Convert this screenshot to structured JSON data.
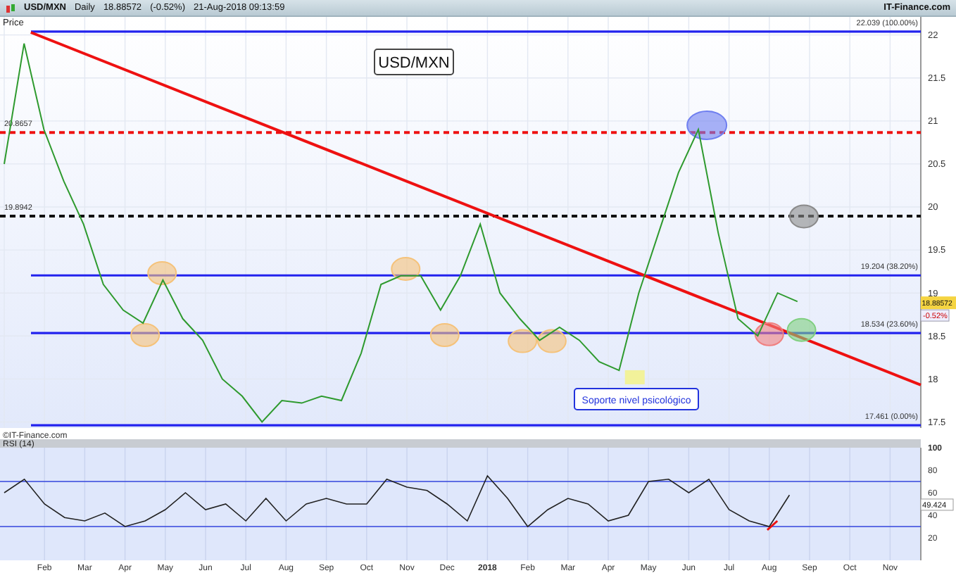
{
  "header": {
    "symbol": "USD/MXN",
    "interval": "Daily",
    "price": "18.88572",
    "change": "(-0.52%)",
    "timestamp": "21-Aug-2018 09:13:59",
    "source": "IT-Finance.com"
  },
  "price_panel": {
    "copyright": "©IT-Finance.com",
    "title_box": "USD/MXN",
    "callout": "Soporte nivel psicológico",
    "price_tag": "18.88572",
    "change_tag": "-0.52%",
    "chart_data": {
      "type": "line",
      "ylabel": "Price",
      "grid": true,
      "ylim": [
        17.43,
        22.21
      ],
      "yticks": [
        17.5,
        18,
        18.5,
        19,
        19.5,
        20,
        20.5,
        21,
        21.5,
        22
      ],
      "series": [
        {
          "color": "#2e9a2e",
          "values": [
            20.5,
            21.9,
            20.9,
            20.3,
            19.8,
            19.1,
            18.8,
            18.65,
            19.15,
            18.7,
            18.45,
            18.0,
            17.8,
            17.5,
            17.75,
            17.72,
            17.8,
            17.75,
            18.3,
            19.1,
            19.2,
            19.2,
            18.8,
            19.2,
            19.8,
            19.0,
            18.7,
            18.45,
            18.6,
            18.45,
            18.2,
            18.1,
            19.0,
            19.7,
            20.4,
            20.9,
            19.7,
            18.7,
            18.5,
            19.0,
            18.9
          ]
        }
      ],
      "ref_lines": [
        {
          "axis": "y",
          "value": 22.039,
          "label": "22.039 (100.00%)",
          "color": "#2222ee"
        },
        {
          "axis": "y",
          "value": 20.8657,
          "label": "20.8657",
          "color": "#ee1111"
        },
        {
          "axis": "y",
          "value": 19.8942,
          "label": "19.8942",
          "color": "#111111"
        },
        {
          "axis": "y",
          "value": 19.204,
          "label": "19.204 (38.20%)",
          "color": "#2222ee"
        },
        {
          "axis": "y",
          "value": 18.534,
          "label": "18.534 (23.60%)",
          "color": "#2222ee"
        },
        {
          "axis": "y",
          "value": 17.461,
          "label": "17.461 (0.00%)",
          "color": "#2222ee"
        }
      ]
    }
  },
  "rsi_panel": {
    "label": "RSI (14)",
    "value_tag": "49.424",
    "chart_data": {
      "type": "line",
      "grid": true,
      "ylim": [
        0,
        100
      ],
      "yticks": [
        20,
        40,
        60,
        80,
        100
      ],
      "categories": [
        null,
        null,
        "Feb",
        null,
        "Mar",
        null,
        "Apr",
        null,
        "May",
        null,
        "Jun",
        null,
        "Jul",
        null,
        "Aug",
        null,
        "Sep",
        null,
        "Oct",
        null,
        "Nov",
        null,
        "Dec",
        null,
        "2018",
        null,
        "Feb",
        null,
        "Mar",
        null,
        "Apr",
        null,
        "May",
        null,
        "Jun",
        null,
        "Jul",
        null,
        "Aug",
        null,
        "Sep",
        null,
        "Oct",
        null,
        "Nov"
      ],
      "series": [
        {
          "color": "#222222",
          "values": [
            60,
            72,
            50,
            38,
            35,
            42,
            30,
            35,
            45,
            60,
            45,
            50,
            35,
            55,
            35,
            50,
            55,
            50,
            50,
            72,
            65,
            62,
            50,
            35,
            75,
            55,
            30,
            45,
            55,
            50,
            35,
            40,
            70,
            72,
            60,
            72,
            45,
            35,
            30,
            58,
            null,
            null,
            null,
            null,
            null
          ]
        }
      ],
      "ref_lines": [
        {
          "axis": "y",
          "value": 70
        },
        {
          "axis": "y",
          "value": 30
        }
      ]
    }
  }
}
